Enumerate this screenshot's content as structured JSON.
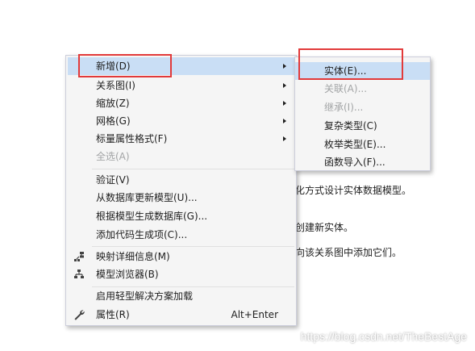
{
  "background_text": {
    "line1": "化方式设计实体数据模型。",
    "line2": "创建新实体。",
    "line3": "向该关系图中添加它们。"
  },
  "context_menu": {
    "items": [
      {
        "label": "新增(D)",
        "submenu": true,
        "highlighted": true
      },
      {
        "label": "关系图(I)",
        "submenu": true
      },
      {
        "label": "缩放(Z)",
        "submenu": true
      },
      {
        "label": "网格(G)",
        "submenu": true
      },
      {
        "label": "标量属性格式(F)",
        "submenu": true
      },
      {
        "label": "全选(A)",
        "disabled": true
      },
      {
        "label": "验证(V)"
      },
      {
        "label": "从数据库更新模型(U)..."
      },
      {
        "label": "根据模型生成数据库(G)..."
      },
      {
        "label": "添加代码生成项(C)..."
      },
      {
        "label": "映射详细信息(M)",
        "icon": "mapping-details-icon"
      },
      {
        "label": "模型浏览器(B)",
        "icon": "model-browser-icon"
      },
      {
        "label": "启用轻型解决方案加载"
      },
      {
        "label": "属性(R)",
        "icon": "wrench-icon",
        "shortcut": "Alt+Enter"
      }
    ]
  },
  "submenu": {
    "items": [
      {
        "label": "实体(E)...",
        "highlighted": true
      },
      {
        "label": "关联(A)...",
        "disabled": true
      },
      {
        "label": "继承(I)...",
        "disabled": true
      },
      {
        "label": "复杂类型(C)"
      },
      {
        "label": "枚举类型(E)..."
      },
      {
        "label": "函数导入(F)..."
      }
    ]
  },
  "watermark": "https://blog.csdn.net/TheBestAge",
  "colors": {
    "menu_background": "#f5f5f5",
    "highlight": "#c9def5",
    "disabled_text": "#a2a4a5",
    "annotation_red": "#e23a3a"
  }
}
